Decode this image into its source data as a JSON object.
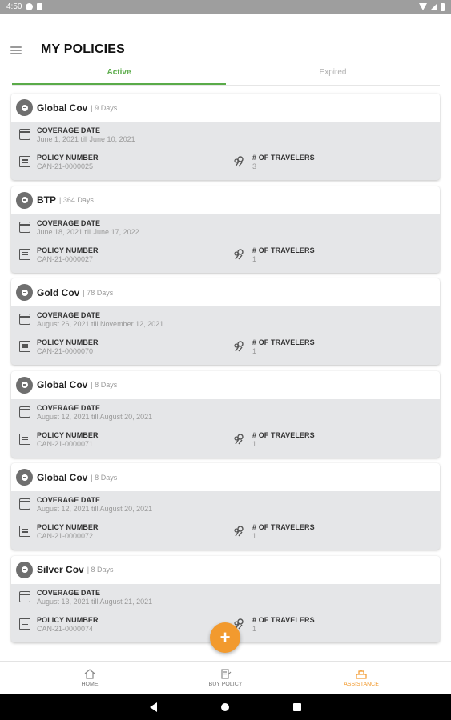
{
  "status_bar": {
    "time": "4:50"
  },
  "header": {
    "title": "MY POLICIES"
  },
  "tabs": [
    {
      "label": "Active",
      "active": true
    },
    {
      "label": "Expired",
      "active": false
    }
  ],
  "labels": {
    "coverage_date": "COVERAGE DATE",
    "policy_number": "POLICY NUMBER",
    "travelers": "# OF TRAVELERS"
  },
  "policies": [
    {
      "name": "Global Cov",
      "days": "| 9 Days",
      "coverage": "June 1, 2021 till June 10, 2021",
      "number": "CAN-21-0000025",
      "travelers": "3"
    },
    {
      "name": "BTP",
      "days": "| 364 Days",
      "coverage": "June 18, 2021 till June 17, 2022",
      "number": "CAN-21-0000027",
      "travelers": "1"
    },
    {
      "name": "Gold Cov",
      "days": "| 78 Days",
      "coverage": "August 26, 2021 till November 12, 2021",
      "number": "CAN-21-0000070",
      "travelers": "1"
    },
    {
      "name": "Global Cov",
      "days": "| 8 Days",
      "coverage": "August 12, 2021 till August 20, 2021",
      "number": "CAN-21-0000071",
      "travelers": "1"
    },
    {
      "name": "Global Cov",
      "days": "| 8 Days",
      "coverage": "August 12, 2021 till August 20, 2021",
      "number": "CAN-21-0000072",
      "travelers": "1"
    },
    {
      "name": "Silver Cov",
      "days": "| 8 Days",
      "coverage": "August 13, 2021 till August 21, 2021",
      "number": "CAN-21-0000074",
      "travelers": "1"
    }
  ],
  "fab": {
    "label": "+"
  },
  "bottom_nav": [
    {
      "label": "HOME",
      "icon": "home-icon"
    },
    {
      "label": "BUY POLICY",
      "icon": "buy-policy-icon"
    },
    {
      "label": "ASSISTANCE",
      "icon": "assistance-icon"
    }
  ],
  "colors": {
    "accent_green": "#5aab49",
    "accent_orange": "#f29a2e",
    "card_body": "#e5e6e8"
  }
}
